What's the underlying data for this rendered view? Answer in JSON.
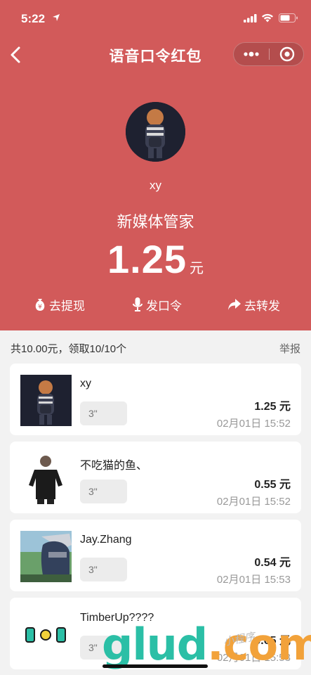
{
  "status_bar": {
    "time": "5:22"
  },
  "nav": {
    "title": "语音口令红包"
  },
  "hero": {
    "sender_name": "xy",
    "org_name": "新媒体管家",
    "amount": "1.25",
    "amount_unit": "元",
    "actions": [
      {
        "label": "去提现",
        "icon": "money-bag-icon"
      },
      {
        "label": "发口令",
        "icon": "microphone-icon"
      },
      {
        "label": "去转发",
        "icon": "share-arrow-icon"
      }
    ]
  },
  "summary": {
    "text": "共10.00元，领取10/10个",
    "report": "举报"
  },
  "list": [
    {
      "name": "xy",
      "voice": "3\"",
      "amount": "1.25 元",
      "time": "02月01日 15:52",
      "avatar": "boy-backpack-avatar"
    },
    {
      "name": "不吃猫的鱼、",
      "voice": "3\"",
      "amount": "0.55 元",
      "time": "02月01日 15:52",
      "avatar": "man-black-shirt-avatar"
    },
    {
      "name": "Jay.Zhang",
      "voice": "3\"",
      "amount": "0.54 元",
      "time": "02月01日 15:53",
      "avatar": "anime-ninja-avatar"
    },
    {
      "name": "TimberUp????",
      "voice": "3\"",
      "amount": "0.65 元",
      "time": "02月01日 15:53",
      "avatar": "bob-logo-avatar"
    }
  ],
  "watermark": {
    "text": "glud.com",
    "cn": "小程序"
  },
  "colors": {
    "primary_red": "#d25a5a",
    "watermark_teal": "#2bbfa6",
    "watermark_orange": "#f2a23a"
  }
}
